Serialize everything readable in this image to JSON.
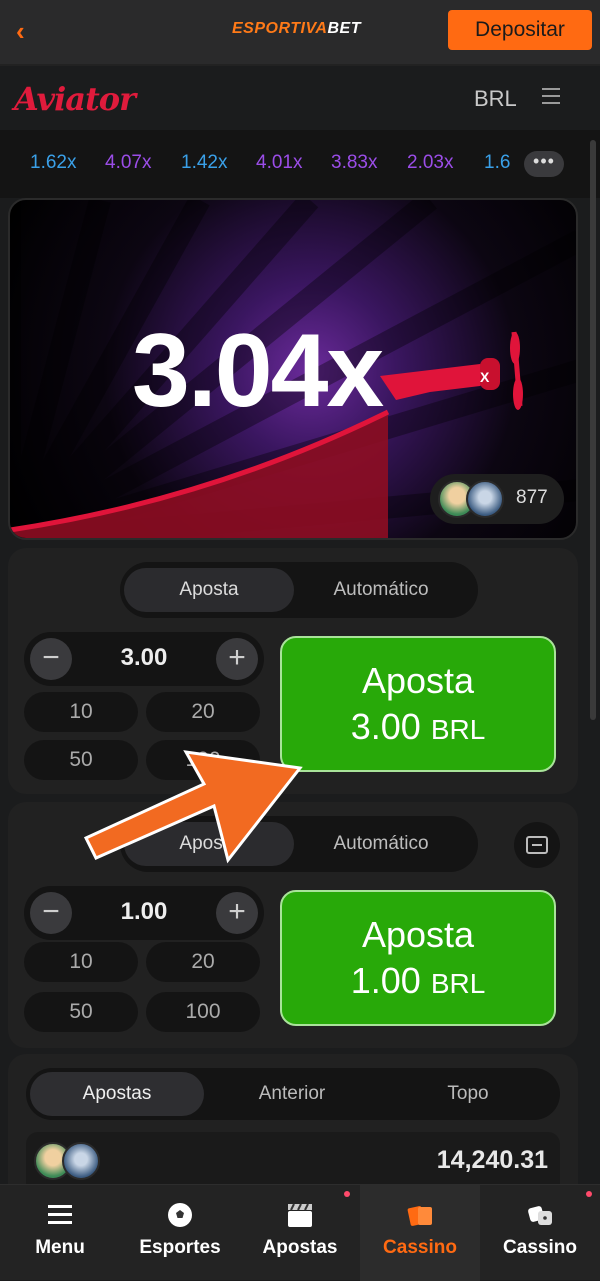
{
  "topbar": {
    "brand_left": "ESPORTIVA",
    "brand_right": "BET",
    "deposit_label": "Depositar"
  },
  "game_header": {
    "logo": "Aviator",
    "currency": "BRL"
  },
  "history": [
    "1.62x",
    "4.07x",
    "1.42x",
    "4.01x",
    "3.83x",
    "2.03x",
    "1.6"
  ],
  "history_colors": [
    "#3aa0e8",
    "#9b4de8",
    "#3aa0e8",
    "#9b4de8",
    "#9b4de8",
    "#9b4de8",
    "#3aa0e8"
  ],
  "more_label": "•••",
  "stage": {
    "multiplier": "3.04x",
    "player_count": "877"
  },
  "panel1": {
    "tab_bet": "Aposta",
    "tab_auto": "Automático",
    "amount": "3.00",
    "minus": "−",
    "plus": "+",
    "chips": [
      "10",
      "20",
      "50",
      "100"
    ],
    "bet_label": "Aposta",
    "bet_amount": "3.00",
    "bet_currency": "BRL"
  },
  "panel2": {
    "tab_bet": "Aposta",
    "tab_auto": "Automático",
    "amount": "1.00",
    "minus": "−",
    "plus": "+",
    "chips": [
      "10",
      "20",
      "50",
      "100"
    ],
    "bet_label": "Aposta",
    "bet_amount": "1.00",
    "bet_currency": "BRL"
  },
  "bets": {
    "tabs": [
      "Apostas",
      "Anterior",
      "Topo"
    ],
    "row_amount": "14,240.31"
  },
  "bottom_nav": [
    {
      "label": "Menu",
      "icon": "menu-icon"
    },
    {
      "label": "Esportes",
      "icon": "soccer-ball-icon"
    },
    {
      "label": "Apostas",
      "icon": "clapperboard-icon"
    },
    {
      "label": "Cassino",
      "icon": "cards-icon"
    },
    {
      "label": "Cassino",
      "icon": "dice-icon"
    }
  ],
  "colors": {
    "accent": "#ff6a12",
    "bet_green": "#28a909",
    "aviator_red": "#e01b3c"
  }
}
